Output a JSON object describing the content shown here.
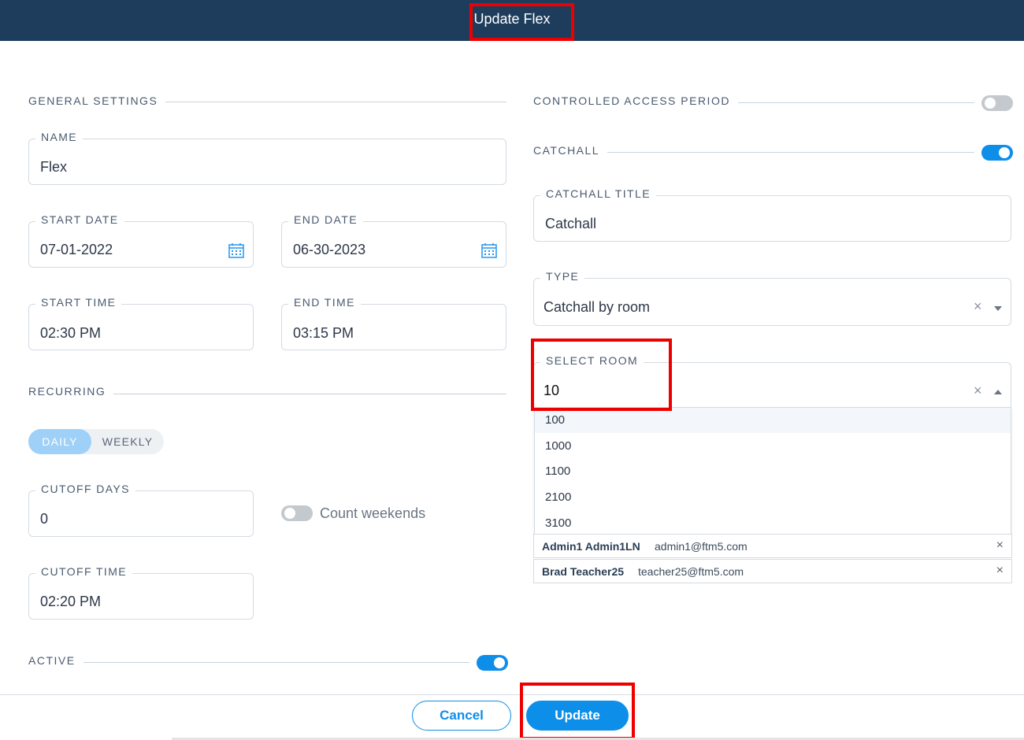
{
  "header": {
    "title": "Update Flex"
  },
  "general": {
    "section_label": "GENERAL SETTINGS",
    "name": {
      "label": "NAME",
      "value": "Flex"
    },
    "start_date": {
      "label": "START DATE",
      "value": "07-01-2022"
    },
    "end_date": {
      "label": "END DATE",
      "value": "06-30-2023"
    },
    "start_time": {
      "label": "START TIME",
      "value": "02:30 PM"
    },
    "end_time": {
      "label": "END TIME",
      "value": "03:15 PM"
    }
  },
  "recurring": {
    "section_label": "RECURRING",
    "options": [
      "DAILY",
      "WEEKLY"
    ],
    "selected": "DAILY",
    "cutoff_days": {
      "label": "CUTOFF DAYS",
      "value": "0"
    },
    "count_weekends": {
      "label": "Count weekends",
      "enabled": false
    },
    "cutoff_time": {
      "label": "CUTOFF TIME",
      "value": "02:20 PM"
    }
  },
  "active": {
    "label": "ACTIVE",
    "enabled": true
  },
  "controlled_access": {
    "label": "CONTROLLED ACCESS PERIOD",
    "enabled": false
  },
  "catchall": {
    "label": "CATCHALL",
    "enabled": true,
    "title": {
      "label": "CATCHALL TITLE",
      "value": "Catchall"
    },
    "type": {
      "label": "TYPE",
      "value": "Catchall by room"
    },
    "select_room": {
      "label": "SELECT ROOM",
      "value": "10",
      "options": [
        "100",
        "1000",
        "1100",
        "2100",
        "3100"
      ],
      "highlighted": "100"
    }
  },
  "users": [
    {
      "name": "Admin1 Admin1LN",
      "email": "admin1@ftm5.com"
    },
    {
      "name": "Brad Teacher25",
      "email": "teacher25@ftm5.com"
    }
  ],
  "footer": {
    "cancel_label": "Cancel",
    "update_label": "Update"
  },
  "colors": {
    "header_bg": "#1e3d5c",
    "accent": "#0d8ee8",
    "highlight_box": "#ee0000"
  }
}
